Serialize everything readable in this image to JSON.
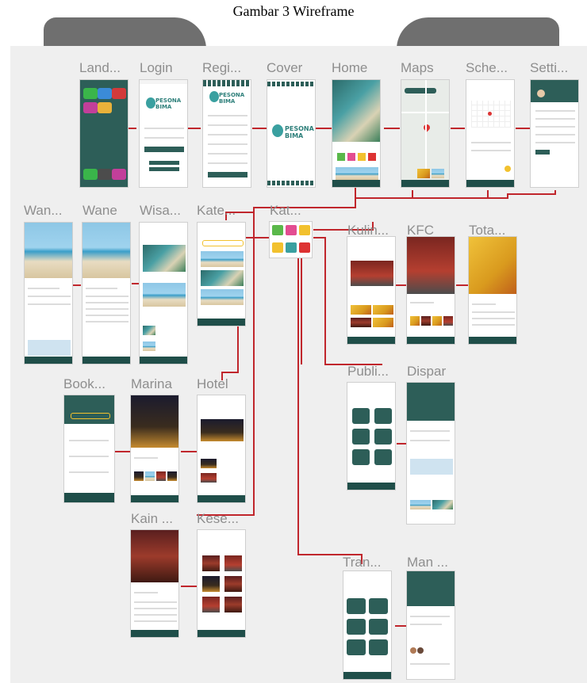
{
  "figure": {
    "caption": "Gambar 3 Wireframe"
  },
  "colors": {
    "wire": "#c0262c",
    "brand_dark": "#1f4e49",
    "accent_yellow": "#f2c12e",
    "label_gray": "#8e8e8e",
    "canvas": "#efefef",
    "tab": "#6f6f6f"
  },
  "screens": {
    "landing": "Land...",
    "login": "Login",
    "register": "Regi...",
    "cover": "Cover",
    "home": "Home",
    "maps": "Maps",
    "schedule": "Sche...",
    "settings": "Setti...",
    "wane_1": "Wan...",
    "wane_2": "Wane",
    "wisata": "Wisa...",
    "kategori": "Kate...",
    "kat": "Kat...",
    "kuliner": "Kulin...",
    "kfc": "KFC",
    "total": "Tota...",
    "booking": "Book...",
    "marina": "Marina",
    "hotel": "Hotel",
    "public": "Publi...",
    "dispar": "Dispar",
    "kain": "Kain ...",
    "kesenian": "Kese...",
    "transport": "Tran...",
    "man": "Man ..."
  },
  "app": {
    "logo_line1": "PESONA",
    "logo_line2": "BIMA"
  }
}
